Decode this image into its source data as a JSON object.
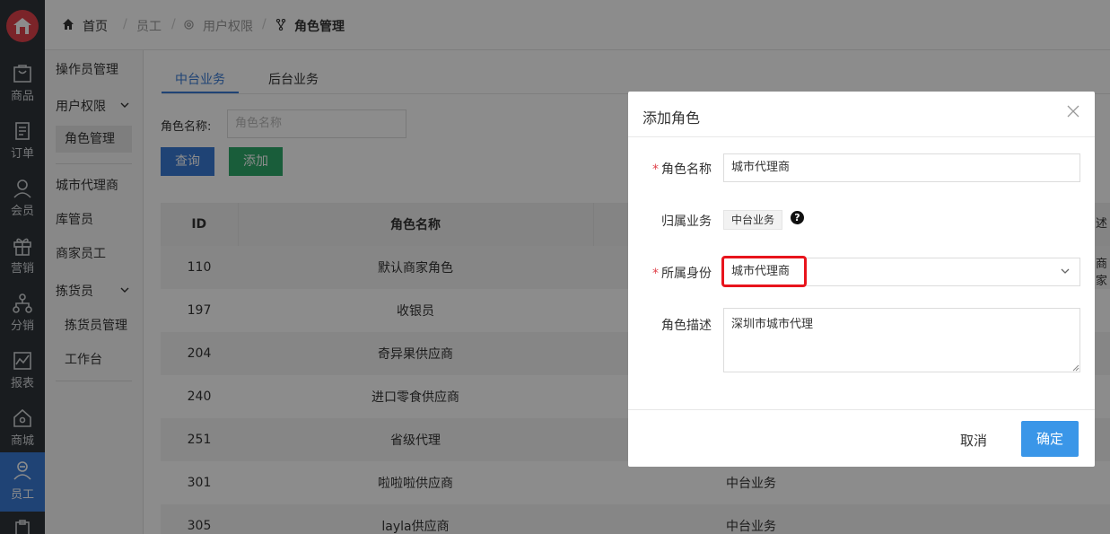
{
  "rail": {
    "items": [
      {
        "label": "商品",
        "icon": "bag-icon"
      },
      {
        "label": "订单",
        "icon": "order-icon"
      },
      {
        "label": "会员",
        "icon": "member-icon"
      },
      {
        "label": "营销",
        "icon": "gift-icon"
      },
      {
        "label": "分销",
        "icon": "distribution-icon"
      },
      {
        "label": "报表",
        "icon": "report-icon"
      },
      {
        "label": "商城",
        "icon": "home-icon"
      },
      {
        "label": "员工",
        "icon": "staff-icon"
      }
    ]
  },
  "breadcrumb": {
    "home": "首页",
    "staff": "员工",
    "permission": "用户权限",
    "current": "角色管理"
  },
  "subnav": {
    "items": [
      "操作员管理",
      "用户权限",
      "角色管理",
      "城市代理商",
      "库管员",
      "商家员工",
      "拣货员",
      "拣货员管理",
      "工作台"
    ]
  },
  "tabs": [
    "中台业务",
    "后台业务"
  ],
  "search": {
    "label": "角色名称:",
    "placeholder": "角色名称",
    "query_btn": "查询",
    "add_btn": "添加"
  },
  "table": {
    "headers": [
      "ID",
      "角色名称"
    ],
    "rows": [
      {
        "id": "110",
        "name": "默认商家角色",
        "biz": ""
      },
      {
        "id": "197",
        "name": "收银员",
        "biz": ""
      },
      {
        "id": "204",
        "name": "奇异果供应商",
        "biz": ""
      },
      {
        "id": "240",
        "name": "进口零食供应商",
        "biz": ""
      },
      {
        "id": "251",
        "name": "省级代理",
        "biz": ""
      },
      {
        "id": "301",
        "name": "啦啦啦供应商",
        "biz": "中台业务"
      },
      {
        "id": "305",
        "name": "layla供应商",
        "biz": "中台业务"
      }
    ],
    "peek_header": "述",
    "peek_cell": "商家"
  },
  "dialog": {
    "title": "添加角色",
    "role_name_label": "角色名称",
    "role_name_value": "城市代理商",
    "business_label": "归属业务",
    "business_value": "中台业务",
    "help": "?",
    "identity_label": "所属身份",
    "identity_value": "城市代理商",
    "desc_label": "角色描述",
    "desc_value": "深圳市城市代理",
    "cancel": "取消",
    "ok": "确定"
  }
}
